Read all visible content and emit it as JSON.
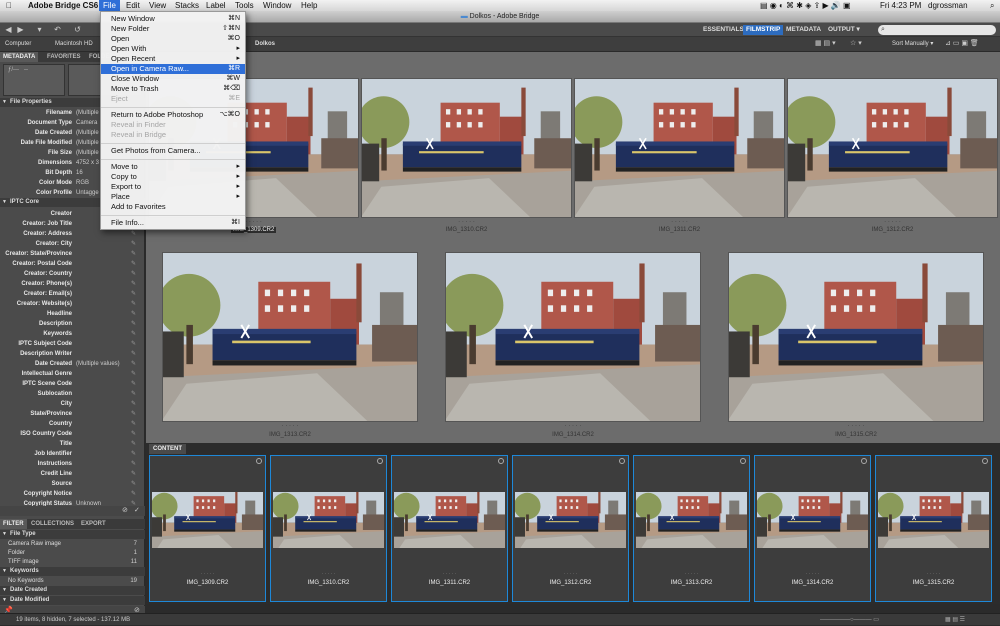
{
  "menubar": {
    "app": "Adobe Bridge CS6",
    "items": [
      "File",
      "Edit",
      "View",
      "Stacks",
      "Label",
      "Tools",
      "Window",
      "Help"
    ],
    "clock": "Fri 4:23 PM",
    "user": "dgrossman"
  },
  "window": {
    "title": "Dolkos - Adobe Bridge"
  },
  "workspaces": [
    "ESSENTIALS",
    "FILMSTRIP",
    "METADATA",
    "OUTPUT ▾"
  ],
  "path": {
    "computer": "Computer",
    "drive": "Macintosh HD",
    "folder": "Dolkos"
  },
  "sort": "Sort Manually ▾",
  "left_tabs": [
    "METADATA",
    "FAVORITES",
    "FOLDERS"
  ],
  "file_properties": {
    "title": "File Properties",
    "rows": [
      {
        "k": "Filename",
        "v": "(Multiple"
      },
      {
        "k": "Document Type",
        "v": "Camera"
      },
      {
        "k": "Date Created",
        "v": "(Multiple"
      },
      {
        "k": "Date File Modified",
        "v": "(Multiple"
      },
      {
        "k": "File Size",
        "v": "(Multiple"
      },
      {
        "k": "Dimensions",
        "v": "4752 x 3"
      },
      {
        "k": "Bit Depth",
        "v": "16"
      },
      {
        "k": "Color Mode",
        "v": "RGB"
      },
      {
        "k": "Color Profile",
        "v": "Untagge"
      }
    ]
  },
  "iptc": {
    "title": "IPTC Core",
    "rows": [
      {
        "k": "Creator",
        "v": ""
      },
      {
        "k": "Creator: Job Title",
        "v": ""
      },
      {
        "k": "Creator: Address",
        "v": ""
      },
      {
        "k": "Creator: City",
        "v": ""
      },
      {
        "k": "Creator: State/Province",
        "v": ""
      },
      {
        "k": "Creator: Postal Code",
        "v": ""
      },
      {
        "k": "Creator: Country",
        "v": ""
      },
      {
        "k": "Creator: Phone(s)",
        "v": ""
      },
      {
        "k": "Creator: Email(s)",
        "v": ""
      },
      {
        "k": "Creator: Website(s)",
        "v": ""
      },
      {
        "k": "Headline",
        "v": ""
      },
      {
        "k": "Description",
        "v": ""
      },
      {
        "k": "Keywords",
        "v": ""
      },
      {
        "k": "IPTC Subject Code",
        "v": ""
      },
      {
        "k": "Description Writer",
        "v": ""
      },
      {
        "k": "Date Created",
        "v": "(Multiple values)"
      },
      {
        "k": "Intellectual Genre",
        "v": ""
      },
      {
        "k": "IPTC Scene Code",
        "v": ""
      },
      {
        "k": "Sublocation",
        "v": ""
      },
      {
        "k": "City",
        "v": ""
      },
      {
        "k": "State/Province",
        "v": ""
      },
      {
        "k": "Country",
        "v": ""
      },
      {
        "k": "ISO Country Code",
        "v": ""
      },
      {
        "k": "Title",
        "v": ""
      },
      {
        "k": "Job Identifier",
        "v": ""
      },
      {
        "k": "Instructions",
        "v": ""
      },
      {
        "k": "Credit Line",
        "v": ""
      },
      {
        "k": "Source",
        "v": ""
      },
      {
        "k": "Copyright Notice",
        "v": ""
      },
      {
        "k": "Copyright Status",
        "v": "Unknown"
      }
    ]
  },
  "filter_tabs": [
    "FILTER",
    "COLLECTIONS",
    "EXPORT"
  ],
  "filter": {
    "file_type": "File Type",
    "rows1": [
      {
        "n": "Camera Raw image",
        "c": "7"
      },
      {
        "n": "Folder",
        "c": "1"
      },
      {
        "n": "TIFF image",
        "c": "11"
      }
    ],
    "keywords": "Keywords",
    "rows2": [
      {
        "n": "No Keywords",
        "c": "19"
      }
    ],
    "date_created": "Date Created",
    "date_modified": "Date Modified"
  },
  "preview": {
    "row1": [
      "IMG_1309.CR2",
      "IMG_1310.CR2",
      "IMG_1311.CR2",
      "IMG_1312.CR2"
    ],
    "row2": [
      "IMG_1313.CR2",
      "IMG_1314.CR2",
      "IMG_1315.CR2"
    ]
  },
  "content": {
    "tab": "CONTENT",
    "items": [
      "IMG_1309.CR2",
      "IMG_1310.CR2",
      "IMG_1311.CR2",
      "IMG_1312.CR2",
      "IMG_1313.CR2",
      "IMG_1314.CR2",
      "IMG_1315.CR2"
    ]
  },
  "status": "19 items, 8 hidden, 7 selected - 137.12 MB",
  "file_menu": [
    {
      "label": "New Window",
      "sc": "⌘N"
    },
    {
      "label": "New Folder",
      "sc": "⇧⌘N"
    },
    {
      "label": "Open",
      "sc": "⌘O"
    },
    {
      "label": "Open With",
      "sc": "▸"
    },
    {
      "label": "Open Recent",
      "sc": "▸"
    },
    {
      "label": "Open in Camera Raw...",
      "sc": "⌘R",
      "hl": true
    },
    {
      "label": "Close Window",
      "sc": "⌘W"
    },
    {
      "label": "Move to Trash",
      "sc": "⌘⌫"
    },
    {
      "label": "Eject",
      "sc": "⌘E",
      "dis": true
    },
    {
      "sep": true
    },
    {
      "label": "Return to Adobe Photoshop",
      "sc": "⌥⌘O"
    },
    {
      "label": "Reveal in Finder",
      "sc": "",
      "dis": true
    },
    {
      "label": "Reveal in Bridge",
      "sc": "",
      "dis": true
    },
    {
      "sep": true
    },
    {
      "label": "Get Photos from Camera...",
      "sc": ""
    },
    {
      "sep": true
    },
    {
      "label": "Move to",
      "sc": "▸"
    },
    {
      "label": "Copy to",
      "sc": "▸"
    },
    {
      "label": "Export to",
      "sc": "▸"
    },
    {
      "label": "Place",
      "sc": "▸"
    },
    {
      "label": "Add to Favorites",
      "sc": ""
    },
    {
      "sep": true
    },
    {
      "label": "File Info...",
      "sc": "⌘I"
    }
  ]
}
